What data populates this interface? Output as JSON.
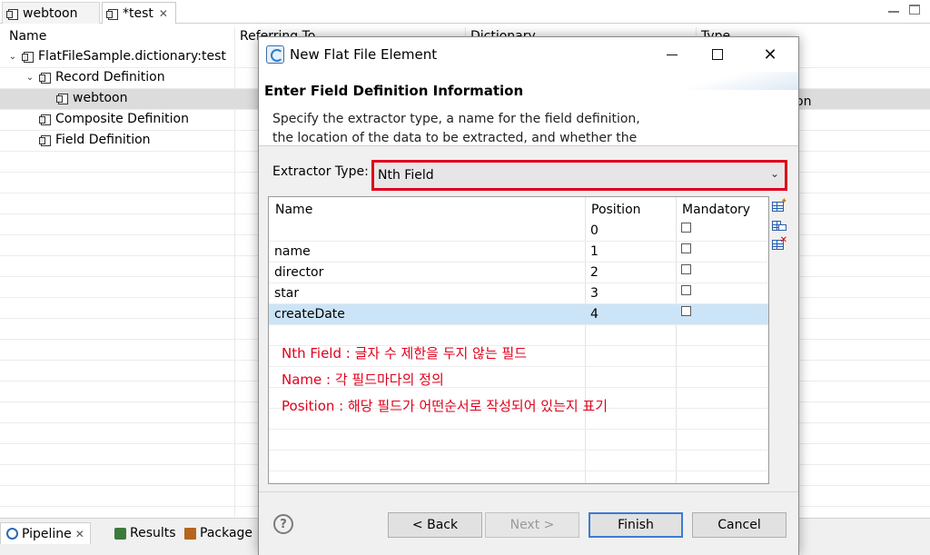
{
  "editor": {
    "tabs": [
      {
        "label": "webtoon",
        "dirty": false
      },
      {
        "label": "*test",
        "dirty": true
      }
    ],
    "tree": {
      "columns": [
        "Name",
        "Referring To",
        "Dictionary",
        "Type"
      ],
      "rows": [
        {
          "label": "FlatFileSample.dictionary:test",
          "expanded": true
        },
        {
          "label": "Record Definition",
          "expanded": true
        },
        {
          "label": "webtoon",
          "selected": true,
          "type_tail": "on"
        },
        {
          "label": "Composite Definition"
        },
        {
          "label": "Field Definition"
        }
      ]
    },
    "bottom_tabs": [
      "Pipeline",
      "Results",
      "Package"
    ]
  },
  "dialog": {
    "title": "New Flat File Element",
    "header_title": "Enter Field Definition Information",
    "header_description": "Specify the extractor type, a name for the field definition, the location of the data to be extracted, and whether the field is",
    "extractor_label": "Extractor Type:",
    "extractor_value": "Nth Field",
    "highlight_color": "#e0001b",
    "table": {
      "columns": [
        "Name",
        "Position",
        "Mandatory"
      ],
      "rows": [
        {
          "name": "",
          "position": "0",
          "mandatory": false
        },
        {
          "name": "name",
          "position": "1",
          "mandatory": false
        },
        {
          "name": "director",
          "position": "2",
          "mandatory": false
        },
        {
          "name": "star",
          "position": "3",
          "mandatory": false
        },
        {
          "name": "createDate",
          "position": "4",
          "mandatory": false,
          "selected": true
        }
      ]
    },
    "annotations": [
      "Nth Field : 글자 수 제한을 두지 않는 필드",
      "Name : 각 필드마다의 정의",
      "Position : 해당 필드가 어떤순서로 작성되어 있는지 표기"
    ],
    "side_tools": [
      "add-row-icon",
      "insert-row-icon",
      "delete-row-icon"
    ],
    "buttons": {
      "help": "?",
      "back": "< Back",
      "next": "Next >",
      "finish": "Finish",
      "cancel": "Cancel"
    }
  }
}
